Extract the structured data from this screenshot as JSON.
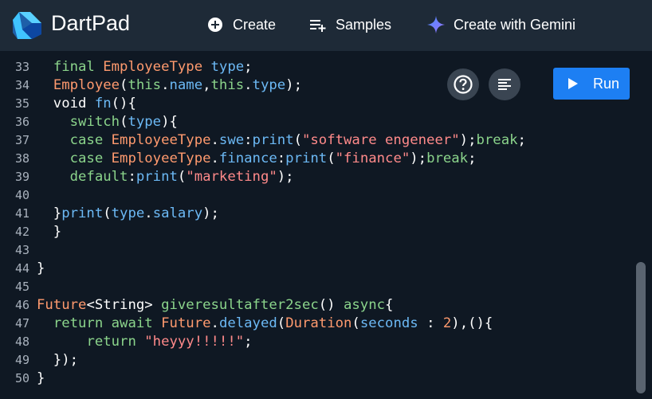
{
  "header": {
    "app_title": "DartPad",
    "nav": {
      "create_label": "Create",
      "samples_label": "Samples",
      "gemini_label": "Create with Gemini"
    }
  },
  "toolbar": {
    "run_label": "Run",
    "help_icon": "help-circle-icon",
    "format_icon": "format-align-icon"
  },
  "editor": {
    "line_numbers": [
      "33",
      "34",
      "35",
      "36",
      "37",
      "38",
      "39",
      "40",
      "41",
      "42",
      "43",
      "44",
      "45",
      "46",
      "47",
      "48",
      "49",
      "50"
    ],
    "lines": [
      [
        {
          "t": "  ",
          "c": "pl"
        },
        {
          "t": "final",
          "c": "kw"
        },
        {
          "t": " ",
          "c": "pl"
        },
        {
          "t": "EmployeeType",
          "c": "ty"
        },
        {
          "t": " ",
          "c": "pl"
        },
        {
          "t": "type",
          "c": "id"
        },
        {
          "t": ";",
          "c": "pl"
        }
      ],
      [
        {
          "t": "  ",
          "c": "pl"
        },
        {
          "t": "Employee",
          "c": "ty"
        },
        {
          "t": "(",
          "c": "pl"
        },
        {
          "t": "this",
          "c": "kw"
        },
        {
          "t": ".",
          "c": "pl"
        },
        {
          "t": "name",
          "c": "id"
        },
        {
          "t": ",",
          "c": "pl"
        },
        {
          "t": "this",
          "c": "kw"
        },
        {
          "t": ".",
          "c": "pl"
        },
        {
          "t": "type",
          "c": "id"
        },
        {
          "t": ");",
          "c": "pl"
        }
      ],
      [
        {
          "t": "  void ",
          "c": "pl"
        },
        {
          "t": "fn",
          "c": "id"
        },
        {
          "t": "(){",
          "c": "pl"
        }
      ],
      [
        {
          "t": "    ",
          "c": "pl"
        },
        {
          "t": "switch",
          "c": "kw"
        },
        {
          "t": "(",
          "c": "pl"
        },
        {
          "t": "type",
          "c": "id"
        },
        {
          "t": "){",
          "c": "pl"
        }
      ],
      [
        {
          "t": "    ",
          "c": "pl"
        },
        {
          "t": "case",
          "c": "kw"
        },
        {
          "t": " ",
          "c": "pl"
        },
        {
          "t": "EmployeeType",
          "c": "ty"
        },
        {
          "t": ".",
          "c": "pl"
        },
        {
          "t": "swe",
          "c": "id"
        },
        {
          "t": ":",
          "c": "pl"
        },
        {
          "t": "print",
          "c": "id"
        },
        {
          "t": "(",
          "c": "pl"
        },
        {
          "t": "\"software engeneer\"",
          "c": "str"
        },
        {
          "t": ");",
          "c": "pl"
        },
        {
          "t": "break",
          "c": "kw"
        },
        {
          "t": ";",
          "c": "pl"
        }
      ],
      [
        {
          "t": "    ",
          "c": "pl"
        },
        {
          "t": "case",
          "c": "kw"
        },
        {
          "t": " ",
          "c": "pl"
        },
        {
          "t": "EmployeeType",
          "c": "ty"
        },
        {
          "t": ".",
          "c": "pl"
        },
        {
          "t": "finance",
          "c": "id"
        },
        {
          "t": ":",
          "c": "pl"
        },
        {
          "t": "print",
          "c": "id"
        },
        {
          "t": "(",
          "c": "pl"
        },
        {
          "t": "\"finance\"",
          "c": "str"
        },
        {
          "t": ");",
          "c": "pl"
        },
        {
          "t": "break",
          "c": "kw"
        },
        {
          "t": ";",
          "c": "pl"
        }
      ],
      [
        {
          "t": "    ",
          "c": "pl"
        },
        {
          "t": "default",
          "c": "kw"
        },
        {
          "t": ":",
          "c": "pl"
        },
        {
          "t": "print",
          "c": "id"
        },
        {
          "t": "(",
          "c": "pl"
        },
        {
          "t": "\"marketing\"",
          "c": "str"
        },
        {
          "t": ");",
          "c": "pl"
        }
      ],
      [],
      [
        {
          "t": "  }",
          "c": "pl"
        },
        {
          "t": "print",
          "c": "id"
        },
        {
          "t": "(",
          "c": "pl"
        },
        {
          "t": "type",
          "c": "id"
        },
        {
          "t": ".",
          "c": "pl"
        },
        {
          "t": "salary",
          "c": "id"
        },
        {
          "t": ");",
          "c": "pl"
        }
      ],
      [
        {
          "t": "  }",
          "c": "pl"
        }
      ],
      [],
      [
        {
          "t": "}",
          "c": "pl"
        }
      ],
      [],
      [
        {
          "t": "Future",
          "c": "ty"
        },
        {
          "t": "<String> ",
          "c": "pl"
        },
        {
          "t": "giveresultafter2sec",
          "c": "kw"
        },
        {
          "t": "() ",
          "c": "pl"
        },
        {
          "t": "async",
          "c": "kw"
        },
        {
          "t": "{",
          "c": "pl"
        }
      ],
      [
        {
          "t": "  ",
          "c": "pl"
        },
        {
          "t": "return",
          "c": "kw"
        },
        {
          "t": " ",
          "c": "pl"
        },
        {
          "t": "await",
          "c": "kw"
        },
        {
          "t": " ",
          "c": "pl"
        },
        {
          "t": "Future",
          "c": "ty"
        },
        {
          "t": ".",
          "c": "pl"
        },
        {
          "t": "delayed",
          "c": "id"
        },
        {
          "t": "(",
          "c": "pl"
        },
        {
          "t": "Duration",
          "c": "ty"
        },
        {
          "t": "(",
          "c": "pl"
        },
        {
          "t": "seconds",
          "c": "id"
        },
        {
          "t": " : ",
          "c": "pl"
        },
        {
          "t": "2",
          "c": "num"
        },
        {
          "t": "),(){",
          "c": "pl"
        }
      ],
      [
        {
          "t": "      ",
          "c": "pl"
        },
        {
          "t": "return",
          "c": "kw"
        },
        {
          "t": " ",
          "c": "pl"
        },
        {
          "t": "\"heyyy!!!!!\"",
          "c": "str"
        },
        {
          "t": ";",
          "c": "pl"
        }
      ],
      [
        {
          "t": "  });",
          "c": "pl"
        }
      ],
      [
        {
          "t": "}",
          "c": "pl"
        }
      ]
    ]
  },
  "colors": {
    "header_bg": "#1e2a37",
    "editor_bg": "#0f1823",
    "run_button": "#1d7ff3"
  }
}
